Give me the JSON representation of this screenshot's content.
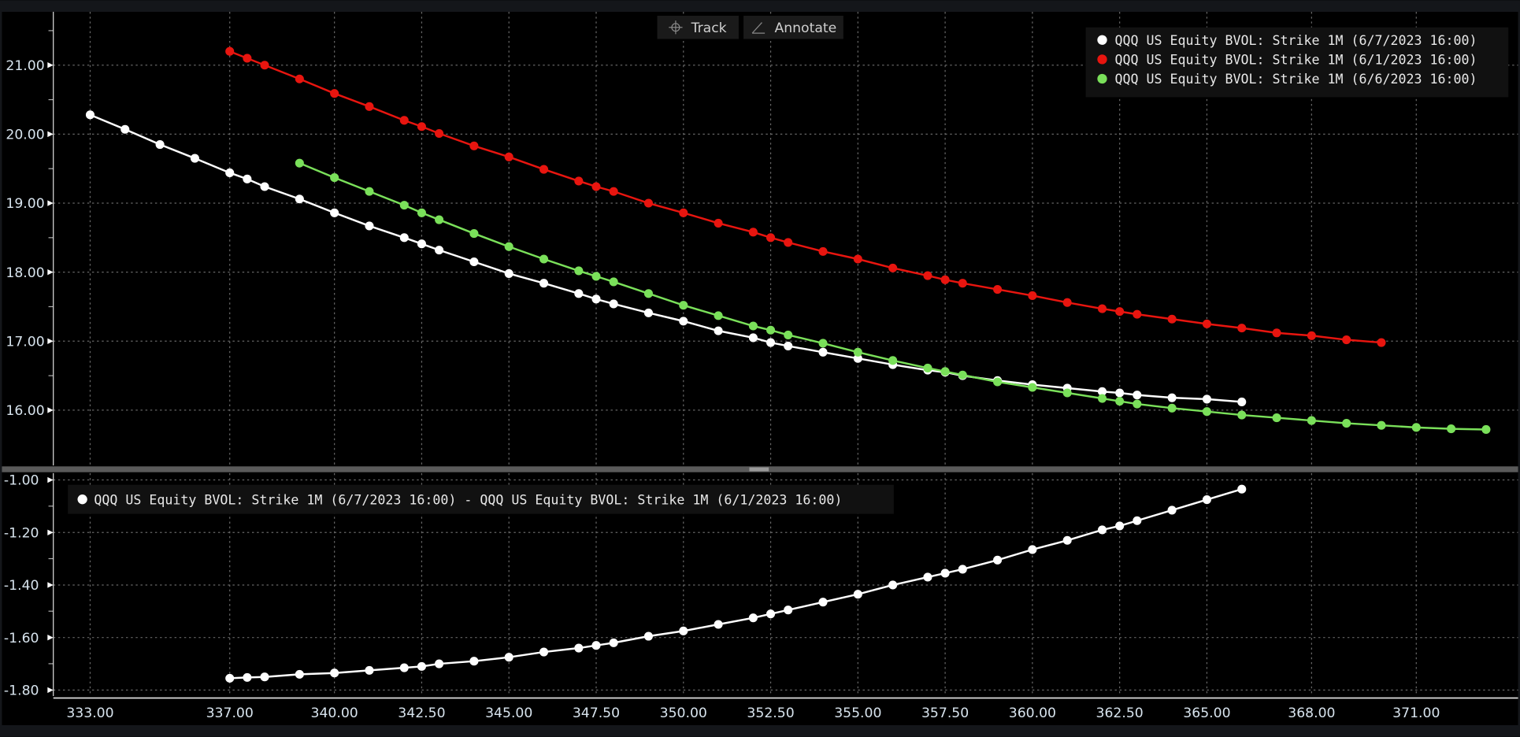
{
  "toolbar": {
    "track_label": "Track",
    "annotate_label": "Annotate",
    "track_icon": "crosshair-icon",
    "annotate_icon": "pencil-icon"
  },
  "colors": {
    "background": "#000000",
    "frame": "#14161a",
    "white_series": "#ffffff",
    "red_series": "#e8150f",
    "green_series": "#7ae05a",
    "grid": "#6a6a6a"
  },
  "chart_data": [
    {
      "type": "line",
      "panel": "upper",
      "grid": true,
      "legend_placement": "top-right",
      "xlim": [
        332,
        374
      ],
      "ylim": [
        15.2,
        21.8
      ],
      "yticks": [
        "21.00",
        "20.00",
        "19.00",
        "18.00",
        "17.00",
        "16.00"
      ],
      "series": [
        {
          "name": "QQQ US Equity BVOL: Strike 1M (6/7/2023 16:00)",
          "color": "#ffffff",
          "x": [
            333,
            334,
            335,
            336,
            337,
            337.5,
            338,
            339,
            340,
            341,
            342,
            342.5,
            343,
            344,
            345,
            346,
            347,
            347.5,
            348,
            349,
            350,
            351,
            352,
            352.5,
            353,
            354,
            355,
            356,
            357,
            357.5,
            358,
            359,
            360,
            361,
            362,
            362.5,
            363,
            364,
            365,
            366
          ],
          "y": [
            20.28,
            20.07,
            19.85,
            19.65,
            19.44,
            19.35,
            19.24,
            19.06,
            18.86,
            18.67,
            18.5,
            18.41,
            18.32,
            18.15,
            17.98,
            17.84,
            17.69,
            17.61,
            17.54,
            17.41,
            17.29,
            17.15,
            17.05,
            16.98,
            16.93,
            16.84,
            16.75,
            16.66,
            16.58,
            16.55,
            16.5,
            16.43,
            16.37,
            16.32,
            16.27,
            16.25,
            16.22,
            16.18,
            16.16,
            16.12
          ]
        },
        {
          "name": "QQQ US Equity BVOL: Strike 1M (6/1/2023 16:00)",
          "color": "#e8150f",
          "x": [
            337,
            337.5,
            338,
            339,
            340,
            341,
            342,
            342.5,
            343,
            344,
            345,
            346,
            347,
            347.5,
            348,
            349,
            350,
            351,
            352,
            352.5,
            353,
            354,
            355,
            356,
            357,
            357.5,
            358,
            359,
            360,
            361,
            362,
            362.5,
            363,
            364,
            365,
            366,
            367,
            368,
            369,
            370
          ],
          "y": [
            21.2,
            21.1,
            21.0,
            20.8,
            20.59,
            20.4,
            20.2,
            20.11,
            20.01,
            19.83,
            19.67,
            19.49,
            19.32,
            19.24,
            19.17,
            19.0,
            18.86,
            18.71,
            18.58,
            18.5,
            18.43,
            18.3,
            18.19,
            18.06,
            17.95,
            17.89,
            17.84,
            17.75,
            17.66,
            17.56,
            17.47,
            17.43,
            17.39,
            17.32,
            17.25,
            17.19,
            17.12,
            17.08,
            17.02,
            16.98
          ]
        },
        {
          "name": "QQQ US Equity BVOL: Strike 1M (6/6/2023 16:00)",
          "color": "#7ae05a",
          "x": [
            339,
            340,
            341,
            342,
            342.5,
            343,
            344,
            345,
            346,
            347,
            347.5,
            348,
            349,
            350,
            351,
            352,
            352.5,
            353,
            354,
            355,
            356,
            357,
            357.5,
            358,
            359,
            360,
            361,
            362,
            362.5,
            363,
            364,
            365,
            366,
            367,
            368,
            369,
            370,
            371,
            372,
            373
          ],
          "y": [
            19.58,
            19.37,
            19.17,
            18.97,
            18.86,
            18.76,
            18.56,
            18.37,
            18.19,
            18.02,
            17.94,
            17.86,
            17.69,
            17.52,
            17.37,
            17.22,
            17.16,
            17.09,
            16.97,
            16.84,
            16.72,
            16.61,
            16.56,
            16.51,
            16.41,
            16.33,
            16.25,
            16.17,
            16.13,
            16.09,
            16.03,
            15.98,
            15.93,
            15.89,
            15.85,
            15.81,
            15.78,
            15.75,
            15.73,
            15.72
          ]
        }
      ]
    },
    {
      "type": "line",
      "panel": "lower",
      "grid": true,
      "legend_placement": "top-left",
      "xlim": [
        332,
        374
      ],
      "ylim": [
        -1.83,
        -0.98
      ],
      "yticks": [
        "-1.00",
        "-1.20",
        "-1.40",
        "-1.60",
        "-1.80"
      ],
      "xticks": [
        "333.00",
        "337.00",
        "340.00",
        "342.50",
        "345.00",
        "347.50",
        "350.00",
        "352.50",
        "355.00",
        "357.50",
        "360.00",
        "362.50",
        "365.00",
        "368.00",
        "371.00"
      ],
      "series": [
        {
          "name": "QQQ US Equity BVOL: Strike 1M (6/7/2023 16:00) - QQQ US Equity BVOL: Strike 1M (6/1/2023 16:00)",
          "color": "#ffffff",
          "x": [
            337,
            337.5,
            338,
            339,
            340,
            341,
            342,
            342.5,
            343,
            344,
            345,
            346,
            347,
            347.5,
            348,
            349,
            350,
            351,
            352,
            352.5,
            353,
            354,
            355,
            356,
            357,
            357.5,
            358,
            359,
            360,
            361,
            362,
            362.5,
            363,
            364,
            365,
            366
          ],
          "y": [
            -1.755,
            -1.752,
            -1.75,
            -1.74,
            -1.735,
            -1.725,
            -1.715,
            -1.71,
            -1.7,
            -1.69,
            -1.675,
            -1.655,
            -1.64,
            -1.63,
            -1.62,
            -1.595,
            -1.575,
            -1.55,
            -1.525,
            -1.51,
            -1.495,
            -1.465,
            -1.435,
            -1.4,
            -1.37,
            -1.355,
            -1.34,
            -1.305,
            -1.265,
            -1.23,
            -1.19,
            -1.175,
            -1.155,
            -1.115,
            -1.075,
            -1.035
          ]
        }
      ]
    }
  ]
}
